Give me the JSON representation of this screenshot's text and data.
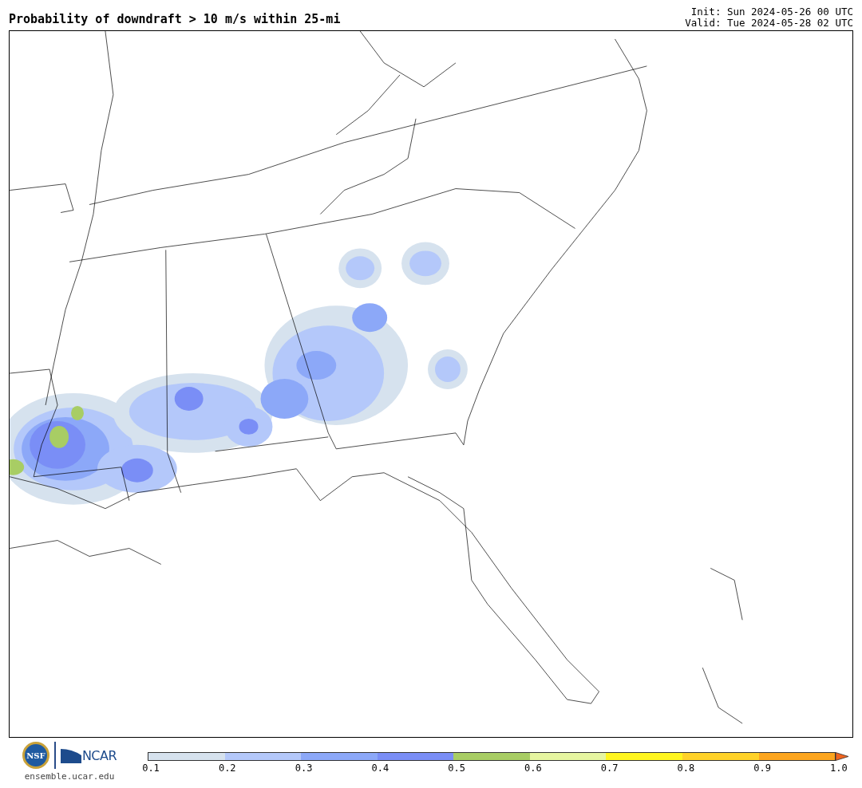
{
  "header": {
    "title": "Probability of downdraft > 10 m/s within 25-mi",
    "init": "Init: Sun 2024-05-26 00 UTC",
    "valid": "Valid: Tue 2024-05-28 02 UTC"
  },
  "footer": {
    "seal_text": "NSF",
    "logo_text": "NCAR",
    "site": "ensemble.ucar.edu"
  },
  "colorbar": {
    "segments": [
      {
        "kind": "band",
        "color": "#d6e2ee"
      },
      {
        "kind": "band",
        "color": "#b4c8fa"
      },
      {
        "kind": "band",
        "color": "#8ca8f8"
      },
      {
        "kind": "band",
        "color": "#7a8ef6"
      },
      {
        "kind": "band",
        "color": "#a8cd64"
      },
      {
        "kind": "band",
        "color": "#e6f5a0"
      },
      {
        "kind": "band",
        "color": "#fff51e"
      },
      {
        "kind": "band",
        "color": "#ffd228"
      },
      {
        "kind": "band",
        "color": "#fca51e"
      },
      {
        "kind": "extend",
        "color": "#f0641e"
      }
    ],
    "ticks": [
      "0.1",
      "0.2",
      "0.3",
      "0.4",
      "0.5",
      "0.6",
      "0.7",
      "0.8",
      "0.9",
      "1.0"
    ]
  }
}
